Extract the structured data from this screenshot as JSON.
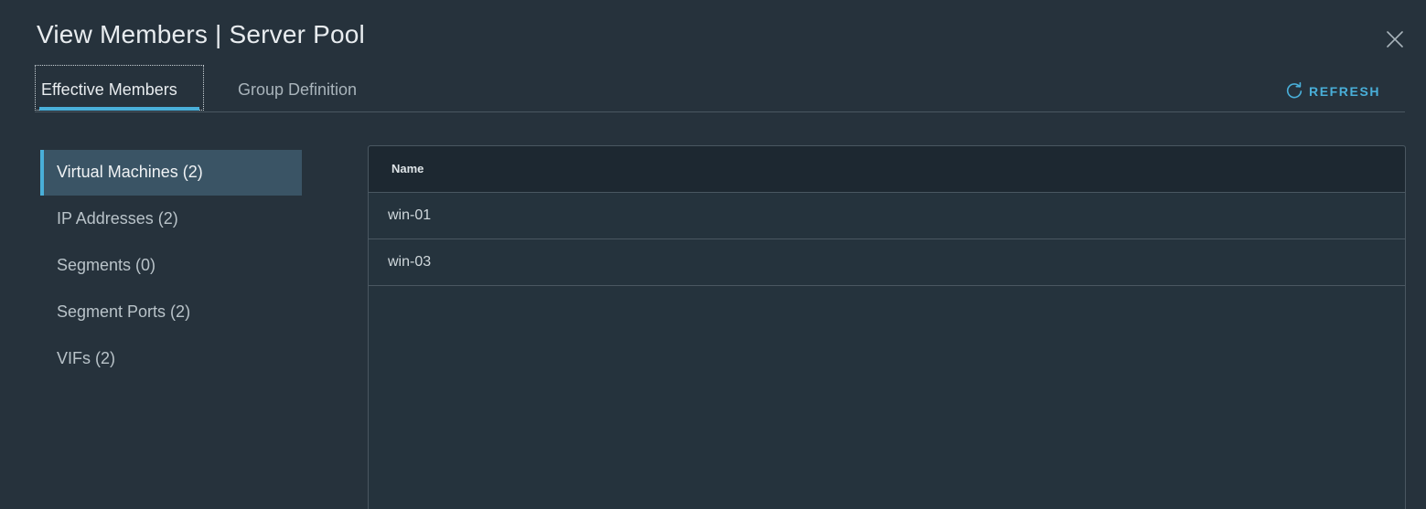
{
  "modal": {
    "title": "View Members | Server Pool"
  },
  "tabs": [
    {
      "label": "Effective Members",
      "active": true
    },
    {
      "label": "Group Definition",
      "active": false
    }
  ],
  "toolbar": {
    "refresh_label": "REFRESH",
    "refresh_icon": "refresh-icon",
    "close_icon": "close-icon"
  },
  "sidebar": {
    "items": [
      {
        "label": "Virtual Machines (2)",
        "active": true
      },
      {
        "label": "IP Addresses (2)",
        "active": false
      },
      {
        "label": "Segments (0)",
        "active": false
      },
      {
        "label": "Segment Ports (2)",
        "active": false
      },
      {
        "label": "VIFs (2)",
        "active": false
      }
    ]
  },
  "grid": {
    "columns": [
      "Name"
    ],
    "rows": [
      [
        "win-01"
      ],
      [
        "win-03"
      ]
    ]
  },
  "colors": {
    "accent": "#49afd9",
    "background": "#26323c",
    "active_nav": "#3a5465"
  }
}
